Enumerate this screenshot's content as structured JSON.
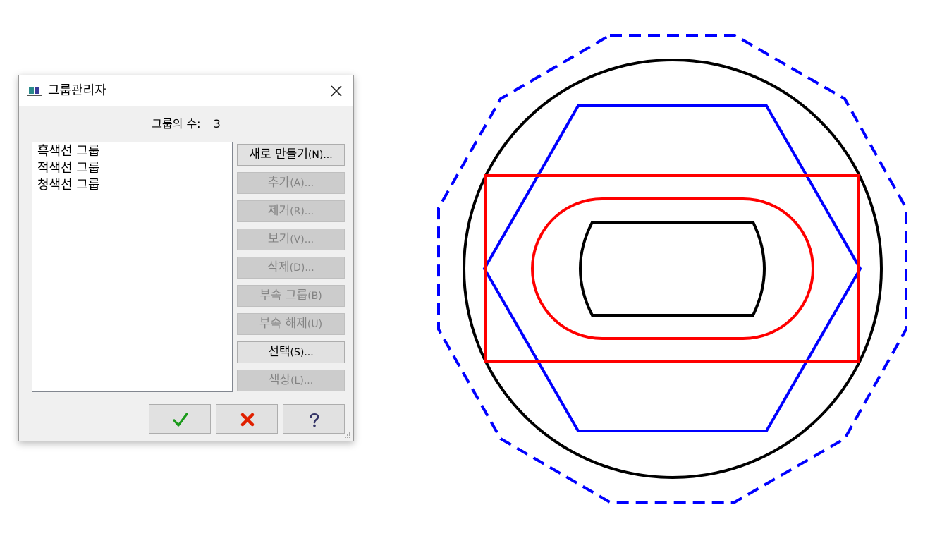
{
  "dialog": {
    "title": "그룹관리자",
    "group_count_label": "그룹의 수:",
    "group_count_value": "3",
    "groups": [
      "흑색선 그룹",
      "적색선 그룹",
      "청색선 그룹"
    ],
    "buttons": {
      "new": {
        "label": "새로 만들기",
        "accel": "(N)..."
      },
      "add": {
        "label": "추가",
        "accel": "(A)..."
      },
      "remove": {
        "label": "제거",
        "accel": "(R)..."
      },
      "view": {
        "label": "보기",
        "accel": "(V)..."
      },
      "delete": {
        "label": "삭제",
        "accel": "(D)..."
      },
      "subgroup": {
        "label": "부속 그룹",
        "accel": "(B)"
      },
      "ungroup": {
        "label": "부속 해제",
        "accel": "(U)"
      },
      "select": {
        "label": "선택",
        "accel": "(S)..."
      },
      "color": {
        "label": "색상",
        "accel": "(L)..."
      }
    },
    "icons": {
      "ok": "checkmark-icon",
      "cancel": "x-icon",
      "help": "question-icon",
      "close": "close-icon"
    }
  },
  "colors": {
    "black_line": "#000000",
    "red_line": "#ff0000",
    "blue_line": "#0000ff",
    "ok_green": "#1a9a1a",
    "cancel_red": "#e02000"
  }
}
